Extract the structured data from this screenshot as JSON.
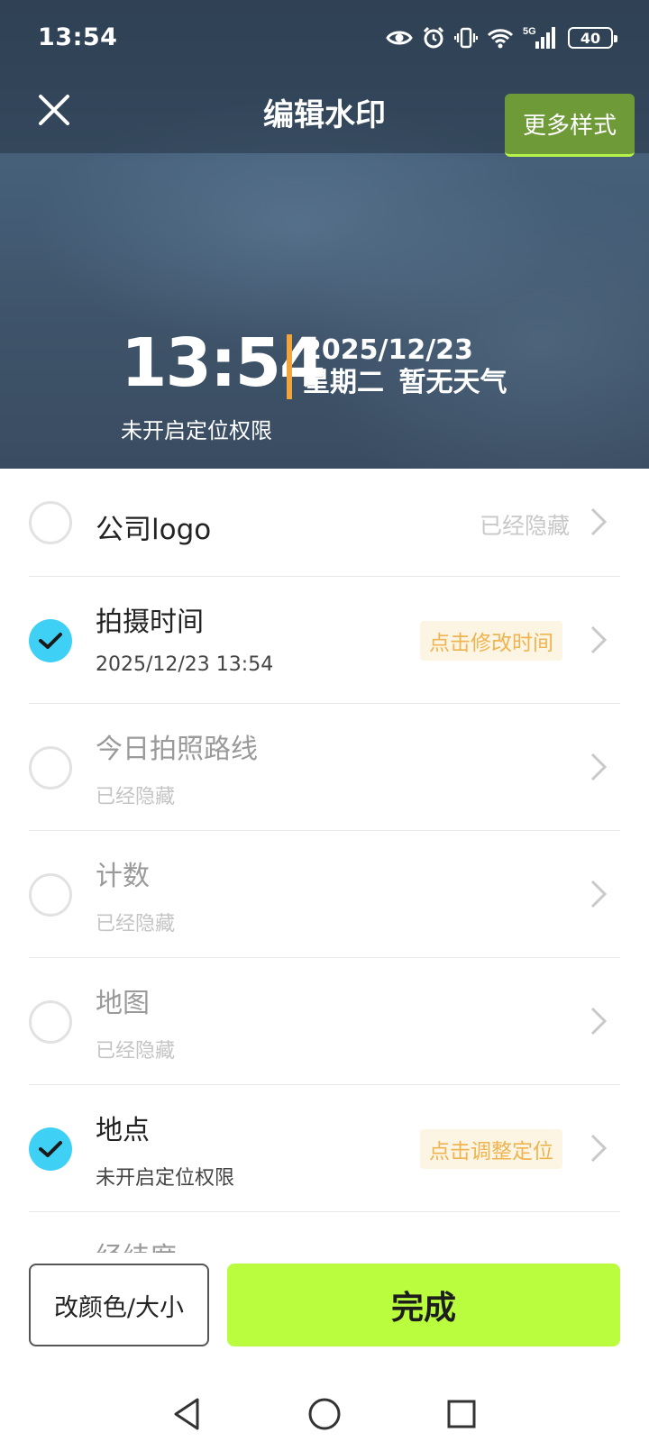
{
  "status_bar": {
    "time": "13:54",
    "network": "5G",
    "battery": "40",
    "icons": [
      "eye-icon",
      "alarm-icon",
      "vibrate-icon",
      "wifi-icon",
      "signal-icon",
      "battery-icon"
    ]
  },
  "header": {
    "title": "编辑水印",
    "more_styles_label": "更多样式",
    "close_icon": "close-icon"
  },
  "watermark": {
    "time": "13:54",
    "date": "2025/12/23",
    "weekday_weather": "星期二 暂无天气",
    "location": "未开启定位权限",
    "accent_color": "#f2a53a"
  },
  "items": [
    {
      "title": "公司logo",
      "checked": false,
      "right_text": "已经隐藏"
    },
    {
      "title": "拍摄时间",
      "checked": true,
      "subtitle": "2025/12/23 13:54",
      "action": "点击修改时间"
    },
    {
      "title": "今日拍照路线",
      "checked": false,
      "subtitle": "已经隐藏"
    },
    {
      "title": "计数",
      "checked": false,
      "subtitle": "已经隐藏"
    },
    {
      "title": "地图",
      "checked": false,
      "subtitle": "已经隐藏"
    },
    {
      "title": "地点",
      "checked": true,
      "subtitle": "未开启定位权限",
      "action": "点击调整定位"
    },
    {
      "title": "经纬度"
    }
  ],
  "footer": {
    "color_size_label": "改颜色/大小",
    "done_label": "完成",
    "done_color": "#b9fd3e"
  },
  "nav": {
    "icons": [
      "back-triangle-icon",
      "home-circle-icon",
      "recents-square-icon"
    ]
  },
  "colors": {
    "check_blue": "#3fd0f5",
    "badge_text": "#efb450",
    "more_styles_bg": "#6e9a38"
  }
}
